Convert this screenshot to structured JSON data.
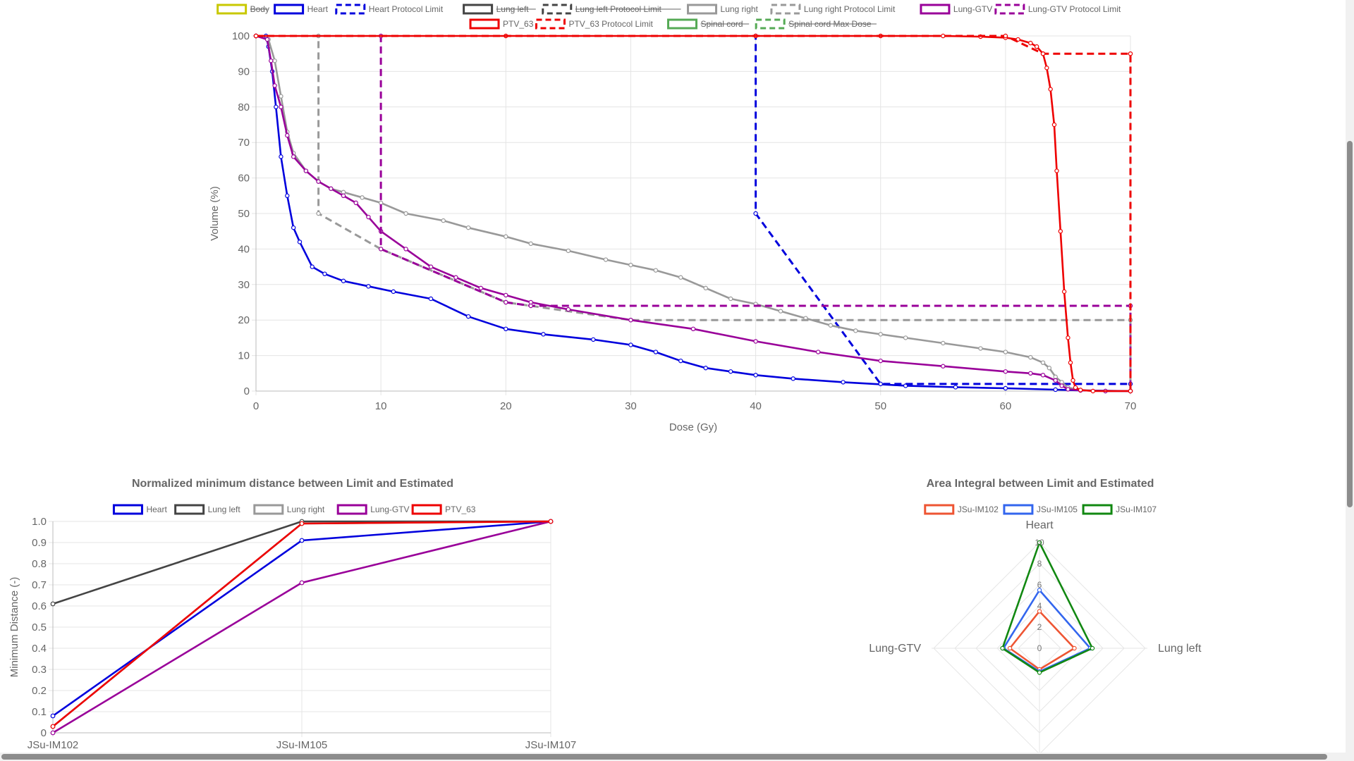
{
  "dvh": {
    "legend": [
      {
        "label": "Body",
        "color": "#c8c800",
        "dashed": false,
        "hidden": true
      },
      {
        "label": "Heart",
        "color": "#0000dd",
        "dashed": false,
        "hidden": false
      },
      {
        "label": "Heart Protocol Limit",
        "color": "#0000dd",
        "dashed": true,
        "hidden": false
      },
      {
        "label": "Lung left",
        "color": "#444444",
        "dashed": false,
        "hidden": true
      },
      {
        "label": "Lung left Protocol Limit",
        "color": "#444444",
        "dashed": true,
        "hidden": true
      },
      {
        "label": "Lung right",
        "color": "#999999",
        "dashed": false,
        "hidden": false
      },
      {
        "label": "Lung right Protocol Limit",
        "color": "#999999",
        "dashed": true,
        "hidden": false
      },
      {
        "label": "Lung-GTV",
        "color": "#990099",
        "dashed": false,
        "hidden": false
      },
      {
        "label": "Lung-GTV Protocol Limit",
        "color": "#990099",
        "dashed": true,
        "hidden": false
      },
      {
        "label": "PTV_63",
        "color": "#ee0000",
        "dashed": false,
        "hidden": false
      },
      {
        "label": "PTV_63 Protocol Limit",
        "color": "#ee0000",
        "dashed": true,
        "hidden": false
      },
      {
        "label": "Spinal cord",
        "color": "#55aa55",
        "dashed": false,
        "hidden": true
      },
      {
        "label": "Spinal cord Max Dose",
        "color": "#55aa55",
        "dashed": true,
        "hidden": true
      }
    ]
  },
  "distance": {
    "title": "Normalized minimum distance between Limit and Estimated",
    "legend": [
      {
        "label": "Heart",
        "color": "#0000dd"
      },
      {
        "label": "Lung left",
        "color": "#444444"
      },
      {
        "label": "Lung right",
        "color": "#999999"
      },
      {
        "label": "Lung-GTV",
        "color": "#990099"
      },
      {
        "label": "PTV_63",
        "color": "#ee0000"
      }
    ]
  },
  "radar": {
    "title": "Area Integral between Limit and Estimated",
    "legend": [
      {
        "label": "JSu-IM102",
        "color": "#ee5533"
      },
      {
        "label": "JSu-IM105",
        "color": "#3366ee"
      },
      {
        "label": "JSu-IM107",
        "color": "#118811"
      }
    ]
  },
  "chart_data": [
    {
      "type": "line",
      "xlabel": "Dose (Gy)",
      "ylabel": "Volume (%)",
      "xlim": [
        0,
        70
      ],
      "ylim": [
        0,
        100
      ],
      "x_ticks": [
        0,
        10,
        20,
        30,
        40,
        50,
        60,
        70
      ],
      "y_ticks": [
        0,
        10,
        20,
        30,
        40,
        50,
        60,
        70,
        80,
        90,
        100
      ],
      "grid": true,
      "series": [
        {
          "name": "Heart",
          "color": "#0000dd",
          "dashed": false,
          "points": [
            [
              0,
              100
            ],
            [
              0.8,
              100
            ],
            [
              1.0,
              97
            ],
            [
              1.3,
              90
            ],
            [
              1.6,
              80
            ],
            [
              2.0,
              66
            ],
            [
              2.5,
              55
            ],
            [
              3.0,
              46
            ],
            [
              3.5,
              42
            ],
            [
              4.5,
              35
            ],
            [
              5.5,
              33
            ],
            [
              7.0,
              31
            ],
            [
              9.0,
              29.5
            ],
            [
              11.0,
              28
            ],
            [
              14.0,
              26
            ],
            [
              17.0,
              21
            ],
            [
              20.0,
              17.5
            ],
            [
              23.0,
              16
            ],
            [
              27.0,
              14.5
            ],
            [
              30.0,
              13
            ],
            [
              32.0,
              11
            ],
            [
              34.0,
              8.5
            ],
            [
              36.0,
              6.5
            ],
            [
              38.0,
              5.5
            ],
            [
              40.0,
              4.5
            ],
            [
              43.0,
              3.5
            ],
            [
              47.0,
              2.5
            ],
            [
              52.0,
              1.5
            ],
            [
              56.0,
              1.1
            ],
            [
              60.0,
              0.8
            ],
            [
              64.0,
              0.4
            ],
            [
              66.0,
              0.2
            ],
            [
              70.0,
              0
            ]
          ]
        },
        {
          "name": "Heart Protocol Limit",
          "color": "#0000dd",
          "dashed": true,
          "points": [
            [
              0,
              100
            ],
            [
              40,
              100
            ],
            [
              40,
              50
            ],
            [
              50,
              2
            ],
            [
              70,
              2
            ],
            [
              70,
              0
            ]
          ]
        },
        {
          "name": "Lung right",
          "color": "#999999",
          "dashed": false,
          "points": [
            [
              0,
              100
            ],
            [
              1.0,
              99
            ],
            [
              1.5,
              93
            ],
            [
              2.0,
              83
            ],
            [
              2.5,
              73
            ],
            [
              3.0,
              67
            ],
            [
              4.0,
              62
            ],
            [
              5.0,
              59
            ],
            [
              6.0,
              57
            ],
            [
              7.0,
              56
            ],
            [
              8.5,
              54.5
            ],
            [
              10,
              53
            ],
            [
              12,
              50
            ],
            [
              15,
              48
            ],
            [
              17,
              46
            ],
            [
              20,
              43.5
            ],
            [
              22,
              41.5
            ],
            [
              25,
              39.5
            ],
            [
              28,
              37
            ],
            [
              30,
              35.5
            ],
            [
              32,
              34
            ],
            [
              34,
              32
            ],
            [
              36,
              29
            ],
            [
              38,
              26
            ],
            [
              40,
              24.5
            ],
            [
              42,
              22.5
            ],
            [
              44,
              20.5
            ],
            [
              46,
              18.5
            ],
            [
              48,
              17
            ],
            [
              50,
              16
            ],
            [
              52,
              15
            ],
            [
              55,
              13.5
            ],
            [
              58,
              12
            ],
            [
              60,
              11
            ],
            [
              62,
              9.5
            ],
            [
              63,
              8
            ],
            [
              63.5,
              6.5
            ],
            [
              64,
              4
            ],
            [
              64.5,
              2.5
            ],
            [
              65,
              1
            ],
            [
              66,
              0.3
            ],
            [
              68,
              0
            ],
            [
              70,
              0
            ]
          ]
        },
        {
          "name": "Lung right Protocol Limit",
          "color": "#999999",
          "dashed": true,
          "points": [
            [
              0,
              100
            ],
            [
              5,
              100
            ],
            [
              5,
              50
            ],
            [
              10,
              40
            ],
            [
              20,
              25
            ],
            [
              30,
              20
            ],
            [
              70,
              20
            ],
            [
              70,
              0
            ]
          ]
        },
        {
          "name": "Lung-GTV",
          "color": "#990099",
          "dashed": false,
          "points": [
            [
              0,
              100
            ],
            [
              0.9,
              99
            ],
            [
              1.2,
              93
            ],
            [
              1.5,
              86
            ],
            [
              2.0,
              80
            ],
            [
              2.5,
              72
            ],
            [
              3.0,
              66
            ],
            [
              4.0,
              62
            ],
            [
              5.0,
              59
            ],
            [
              6.0,
              57
            ],
            [
              7.0,
              55
            ],
            [
              8.0,
              53
            ],
            [
              9.0,
              49
            ],
            [
              10,
              45
            ],
            [
              12,
              40
            ],
            [
              14,
              35
            ],
            [
              16,
              32
            ],
            [
              18,
              29
            ],
            [
              20,
              27
            ],
            [
              22,
              25
            ],
            [
              25,
              23
            ],
            [
              30,
              20
            ],
            [
              35,
              17.5
            ],
            [
              40,
              14
            ],
            [
              45,
              11
            ],
            [
              50,
              8.5
            ],
            [
              55,
              7
            ],
            [
              60,
              5.5
            ],
            [
              62,
              5
            ],
            [
              63,
              4.5
            ],
            [
              64,
              3
            ],
            [
              64.5,
              1.5
            ],
            [
              65,
              0.5
            ],
            [
              66,
              0.2
            ],
            [
              68,
              0
            ],
            [
              70,
              0
            ]
          ]
        },
        {
          "name": "Lung-GTV Protocol Limit",
          "color": "#990099",
          "dashed": true,
          "points": [
            [
              0,
              100
            ],
            [
              10,
              100
            ],
            [
              10,
              40
            ],
            [
              20,
              25
            ],
            [
              22,
              24
            ],
            [
              70,
              24
            ],
            [
              70,
              0
            ]
          ]
        },
        {
          "name": "PTV_63",
          "color": "#ee0000",
          "dashed": false,
          "points": [
            [
              0,
              100
            ],
            [
              20,
              100
            ],
            [
              40,
              100
            ],
            [
              50,
              100
            ],
            [
              55,
              100
            ],
            [
              58,
              99.8
            ],
            [
              60,
              99.5
            ],
            [
              61,
              99
            ],
            [
              62,
              98
            ],
            [
              62.5,
              97
            ],
            [
              63,
              95
            ],
            [
              63.3,
              91
            ],
            [
              63.6,
              85
            ],
            [
              63.9,
              75
            ],
            [
              64.1,
              62
            ],
            [
              64.4,
              45
            ],
            [
              64.7,
              28
            ],
            [
              65,
              15
            ],
            [
              65.2,
              8
            ],
            [
              65.4,
              3
            ],
            [
              65.6,
              1
            ],
            [
              66,
              0.3
            ],
            [
              67,
              0
            ],
            [
              70,
              0
            ]
          ]
        },
        {
          "name": "PTV_63 Protocol Limit",
          "color": "#ee0000",
          "dashed": true,
          "points": [
            [
              0,
              100
            ],
            [
              60,
              100
            ],
            [
              63,
              95
            ],
            [
              70,
              95
            ],
            [
              70,
              0
            ]
          ]
        }
      ]
    },
    {
      "type": "line",
      "title": "Normalized minimum distance between Limit and Estimated",
      "ylabel": "Minimum Distance (-)",
      "categories": [
        "JSu-IM102",
        "JSu-IM105",
        "JSu-IM107"
      ],
      "ylim": [
        0,
        1.0
      ],
      "y_ticks": [
        0,
        0.1,
        0.2,
        0.3,
        0.4,
        0.5,
        0.6,
        0.7,
        0.8,
        0.9,
        1.0
      ],
      "series": [
        {
          "name": "Heart",
          "color": "#0000dd",
          "values": [
            0.08,
            0.91,
            1.0
          ]
        },
        {
          "name": "Lung left",
          "color": "#444444",
          "values": [
            0.61,
            1.0,
            1.0
          ]
        },
        {
          "name": "Lung right",
          "color": "#999999",
          "values": [
            0.03,
            0.99,
            1.0
          ]
        },
        {
          "name": "Lung-GTV",
          "color": "#990099",
          "values": [
            0.0,
            0.71,
            1.0
          ]
        },
        {
          "name": "PTV_63",
          "color": "#ee0000",
          "values": [
            0.03,
            0.99,
            1.0
          ]
        }
      ]
    },
    {
      "type": "radar",
      "title": "Area Integral between Limit and Estimated",
      "axes": [
        "Heart",
        "Lung left",
        "",
        "Lung-GTV"
      ],
      "r_ticks": [
        0,
        2,
        4,
        6,
        8,
        10
      ],
      "r_max": 10,
      "series": [
        {
          "name": "JSu-IM102",
          "color": "#ee5533",
          "values": [
            3.5,
            3.3,
            2.0,
            2.8
          ]
        },
        {
          "name": "JSu-IM105",
          "color": "#3366ee",
          "values": [
            5.5,
            4.8,
            2.2,
            3.4
          ]
        },
        {
          "name": "JSu-IM107",
          "color": "#118811",
          "values": [
            10.0,
            5.0,
            2.3,
            3.5
          ]
        }
      ]
    }
  ]
}
